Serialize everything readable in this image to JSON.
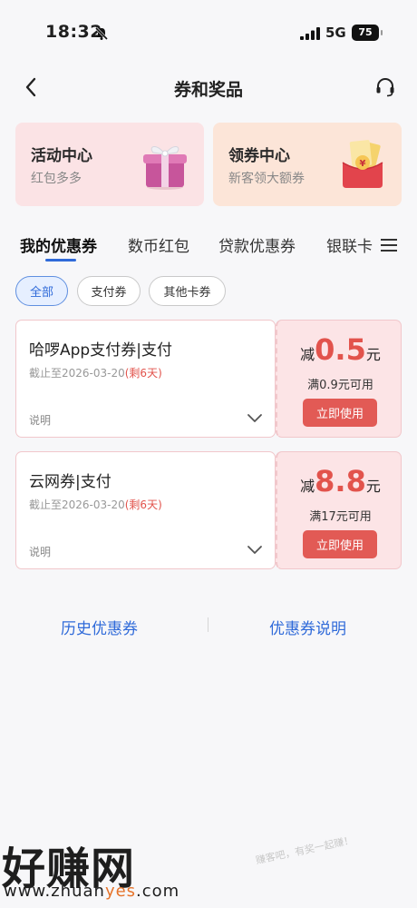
{
  "status_bar": {
    "time": "18:32",
    "network": "5G",
    "battery": "75"
  },
  "nav": {
    "title": "券和奖品"
  },
  "feature_cards": [
    {
      "title": "活动中心",
      "subtitle": "红包多多"
    },
    {
      "title": "领券中心",
      "subtitle": "新客领大额券"
    }
  ],
  "tabs": [
    "我的优惠券",
    "数币红包",
    "贷款优惠券",
    "银联卡"
  ],
  "filters": [
    "全部",
    "支付券",
    "其他卡券"
  ],
  "coupons": [
    {
      "name": "哈啰App支付券|支付",
      "expiry": "截止至2026-03-20",
      "remaining": "(剩6天)",
      "desc_label": "说明",
      "amount_prefix": "减",
      "amount": "0.5",
      "amount_unit": "元",
      "condition": "满0.9元可用",
      "button": "立即使用"
    },
    {
      "name": "云网券|支付",
      "expiry": "截止至2026-03-20",
      "remaining": "(剩6天)",
      "desc_label": "说明",
      "amount_prefix": "减",
      "amount": "8.8",
      "amount_unit": "元",
      "condition": "满17元可用",
      "button": "立即使用"
    }
  ],
  "bottom_links": [
    "历史优惠券",
    "优惠券说明"
  ],
  "watermark": {
    "brand": "好赚网",
    "url_start": "www.zhuan",
    "url_mid": "yes",
    "url_end": ".com",
    "slogan": "赚客吧，有奖一起赚！"
  },
  "colors": {
    "accent_blue": "#2f6ad9",
    "accent_red": "#e2534c",
    "card_pink": "#fbe3e5",
    "card_peach": "#fce5d8"
  },
  "icons": [
    "bell-muted-icon",
    "signal-icon",
    "back-icon",
    "headset-icon",
    "gift-box-icon",
    "red-envelope-icon",
    "menu-icon",
    "chevron-down-icon"
  ]
}
